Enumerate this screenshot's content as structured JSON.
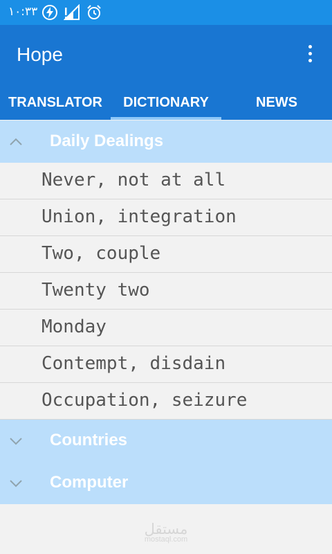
{
  "status_bar": {
    "time": "١٠:٣٣",
    "icons": [
      "battery-charging-icon",
      "signal-icon",
      "alarm-icon"
    ]
  },
  "app_bar": {
    "title": "Hope",
    "overflow_icon": "more-vert-icon"
  },
  "tabs": [
    {
      "label": "TRANSLATOR",
      "selected": false
    },
    {
      "label": "DICTIONARY",
      "selected": true
    },
    {
      "label": "NEWS",
      "selected": false
    }
  ],
  "groups": [
    {
      "label": "Daily Dealings",
      "expanded": true,
      "items": [
        "Never, not at all",
        "Union, integration",
        "Two, couple",
        "Twenty two",
        "Monday",
        "Contempt, disdain",
        "Occupation, seizure"
      ]
    },
    {
      "label": "Countries",
      "expanded": false
    },
    {
      "label": "Computer",
      "expanded": false
    }
  ],
  "watermark": {
    "logo": "مستقل",
    "url": "mostaql.com"
  },
  "colors": {
    "status_bar": "#1b8fe6",
    "app_bar": "#1976d2",
    "group_header": "#bbdefb",
    "background": "#f2f2f2",
    "text": "#555555"
  }
}
